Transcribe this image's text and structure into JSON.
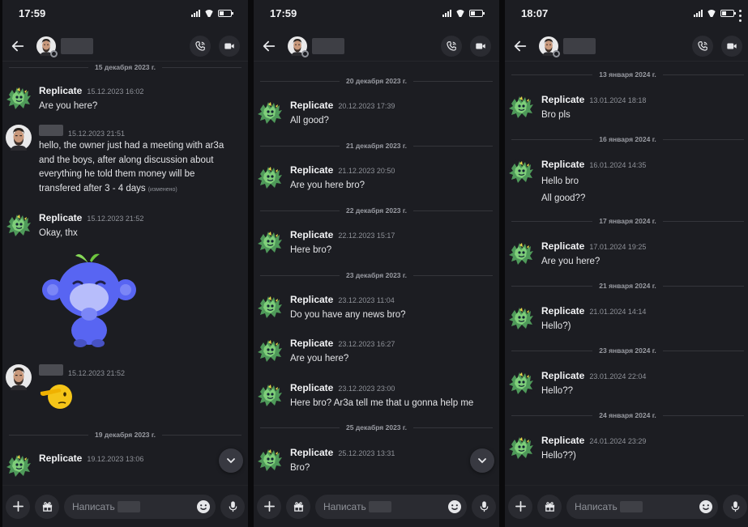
{
  "screens": [
    {
      "time": "17:59",
      "dividers": [
        "15 декабря 2023 г.",
        "19 декабря 2023 г."
      ],
      "messages": [
        {
          "user": "Replicate",
          "ts": "15.12.2023 16:02",
          "lines": [
            "Are you here?"
          ]
        },
        {
          "user": "",
          "ts": "15.12.2023 21:51",
          "lines": [
            "hello, the owner just had a meeting with ar3a",
            "and the boys, after along discussion about",
            "everything he told them money will be",
            "transfered after 3 - 4 days"
          ],
          "edited": "(изменено)"
        },
        {
          "user": "Replicate",
          "ts": "15.12.2023 21:52",
          "lines": [
            "Okay, thx"
          ]
        },
        {
          "user": "",
          "ts": "15.12.2023 21:52",
          "lines": []
        },
        {
          "user": "Replicate",
          "ts": "19.12.2023 13:06",
          "lines": []
        }
      ],
      "composer_placeholder": "Написать"
    },
    {
      "time": "17:59",
      "dividers": [
        "20 декабря 2023 г.",
        "21 декабря 2023 г.",
        "22 декабря 2023 г.",
        "23 декабря 2023 г.",
        "25 декабря 2023 г."
      ],
      "messages": [
        {
          "user": "Replicate",
          "ts": "20.12.2023 17:39",
          "lines": [
            "All good?"
          ]
        },
        {
          "user": "Replicate",
          "ts": "21.12.2023 20:50",
          "lines": [
            "Are you here bro?"
          ]
        },
        {
          "user": "Replicate",
          "ts": "22.12.2023 15:17",
          "lines": [
            "Here bro?"
          ]
        },
        {
          "user": "Replicate",
          "ts": "23.12.2023 11:04",
          "lines": [
            "Do you have any news bro?"
          ]
        },
        {
          "user": "Replicate",
          "ts": "23.12.2023 16:27",
          "lines": [
            "Are you here?"
          ]
        },
        {
          "user": "Replicate",
          "ts": "23.12.2023 23:00",
          "lines": [
            "Here bro? Ar3a tell me that u gonna help me"
          ]
        },
        {
          "user": "Replicate",
          "ts": "25.12.2023 13:31",
          "lines": [
            "Bro?"
          ]
        }
      ],
      "composer_placeholder": "Написать"
    },
    {
      "time": "18:07",
      "dividers": [
        "13 января 2024 г.",
        "16 января 2024 г.",
        "17 января 2024 г.",
        "21 января 2024 г.",
        "23 января 2024 г.",
        "24 января 2024 г."
      ],
      "messages": [
        {
          "user": "Replicate",
          "ts": "13.01.2024 18:18",
          "lines": [
            "Bro pls"
          ]
        },
        {
          "user": "Replicate",
          "ts": "16.01.2024 14:35",
          "lines": [
            "Hello bro",
            "All good??"
          ]
        },
        {
          "user": "Replicate",
          "ts": "17.01.2024 19:25",
          "lines": [
            "Are you here?"
          ]
        },
        {
          "user": "Replicate",
          "ts": "21.01.2024 14:14",
          "lines": [
            "Hello?)"
          ]
        },
        {
          "user": "Replicate",
          "ts": "23.01.2024 22:04",
          "lines": [
            "Hello??"
          ]
        },
        {
          "user": "Replicate",
          "ts": "24.01.2024 23:29",
          "lines": [
            "Hello??)"
          ]
        }
      ],
      "composer_placeholder": "Написать"
    }
  ],
  "icons": {
    "back": "arrow-left-icon",
    "call": "phone-call-icon",
    "video": "video-camera-icon",
    "add": "plus-icon",
    "gift": "gift-icon",
    "emoji": "smiley-icon",
    "mic": "microphone-icon",
    "scroll": "chevron-down-icon"
  },
  "colors": {
    "background": "#1c1d22",
    "surface": "#2a2b31",
    "divider_text": "#9a9ca3"
  }
}
